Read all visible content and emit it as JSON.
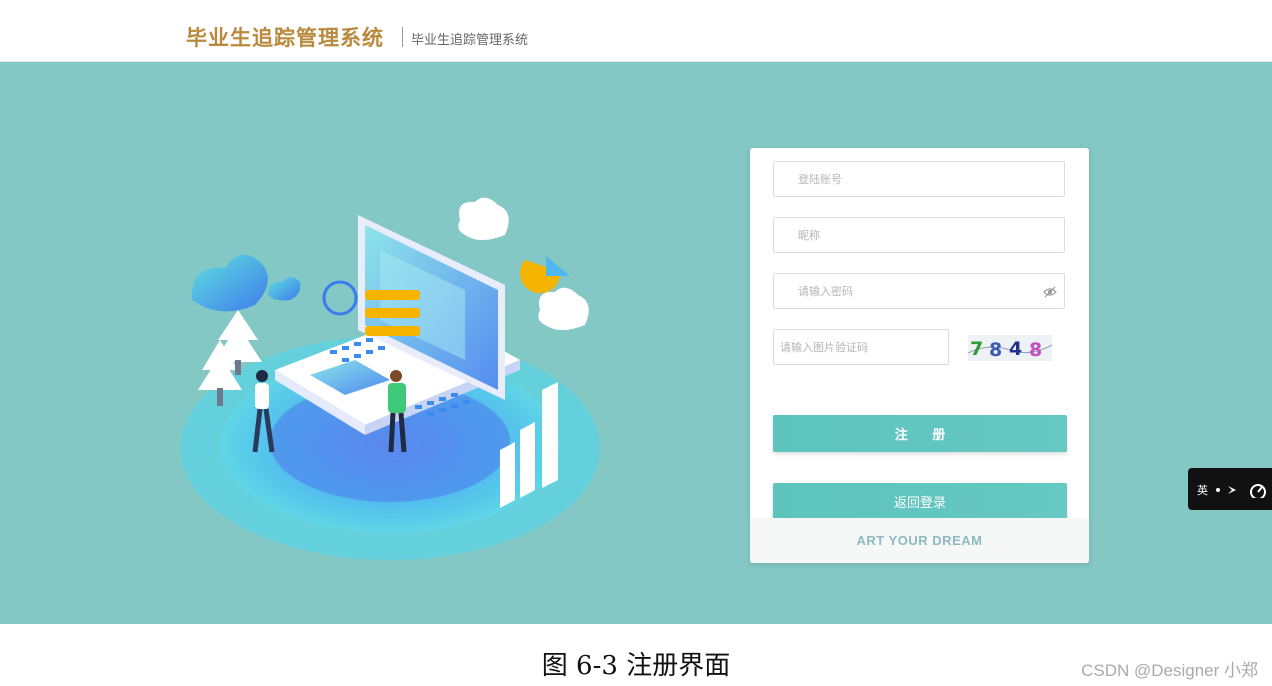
{
  "header": {
    "brand_title": "毕业生追踪管理系统",
    "brand_subtitle": "毕业生追踪管理系统"
  },
  "form": {
    "account_placeholder": "登陆账号",
    "nickname_placeholder": "昵称",
    "password_placeholder": "请输入密码",
    "captcha_placeholder": "请输入图片验证码",
    "captcha_code": [
      "7",
      "8",
      "4",
      "8"
    ],
    "register_label": "注 册",
    "back_to_login_label": "返回登录",
    "footer_slogan": "ART YOUR DREAM"
  },
  "side_widget": {
    "lang_label": "英"
  },
  "caption": "图 6-3  注册界面",
  "watermark": "CSDN @Designer 小郑",
  "colors": {
    "hero_bg": "#83c8c4",
    "button": "#5dc3bd",
    "brand": "#b98a3e"
  }
}
